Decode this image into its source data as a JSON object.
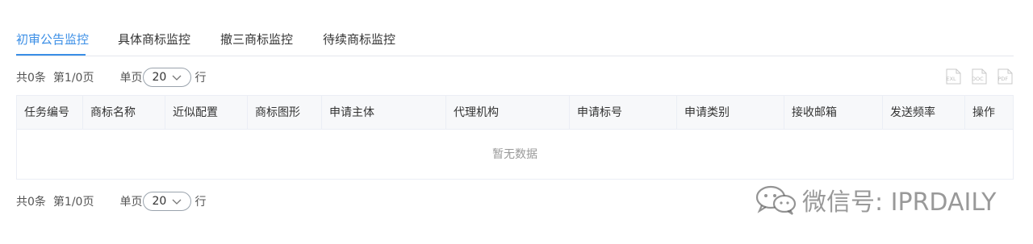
{
  "tabs": [
    {
      "label": "初审公告监控",
      "active": true
    },
    {
      "label": "具体商标监控",
      "active": false
    },
    {
      "label": "撤三商标监控",
      "active": false
    },
    {
      "label": "待续商标监控",
      "active": false
    }
  ],
  "pager_top": {
    "total": "共0条",
    "page_info": "第1/0页",
    "page_size_label": "单页",
    "page_size": "20",
    "rows_suffix": "行"
  },
  "pager_bottom": {
    "total": "共0条",
    "page_info": "第1/0页",
    "page_size_label": "单页",
    "page_size": "20",
    "rows_suffix": "行"
  },
  "export_buttons": [
    {
      "label": "EXL",
      "icon": "excel-export-icon"
    },
    {
      "label": "DOC",
      "icon": "doc-export-icon"
    },
    {
      "label": "PDF",
      "icon": "pdf-export-icon"
    }
  ],
  "table": {
    "columns": [
      "任务编号",
      "商标名称",
      "近似配置",
      "商标图形",
      "申请主体",
      "代理机构",
      "申请标号",
      "申请类别",
      "接收邮箱",
      "发送频率",
      "操作"
    ],
    "empty_text": "暂无数据"
  },
  "watermark": {
    "text": "微信号: IPRDAILY"
  },
  "colors": {
    "accent": "#3a8ee6",
    "border": "#ebeef5",
    "header_bg": "#f7f8fa",
    "muted": "#999999"
  }
}
